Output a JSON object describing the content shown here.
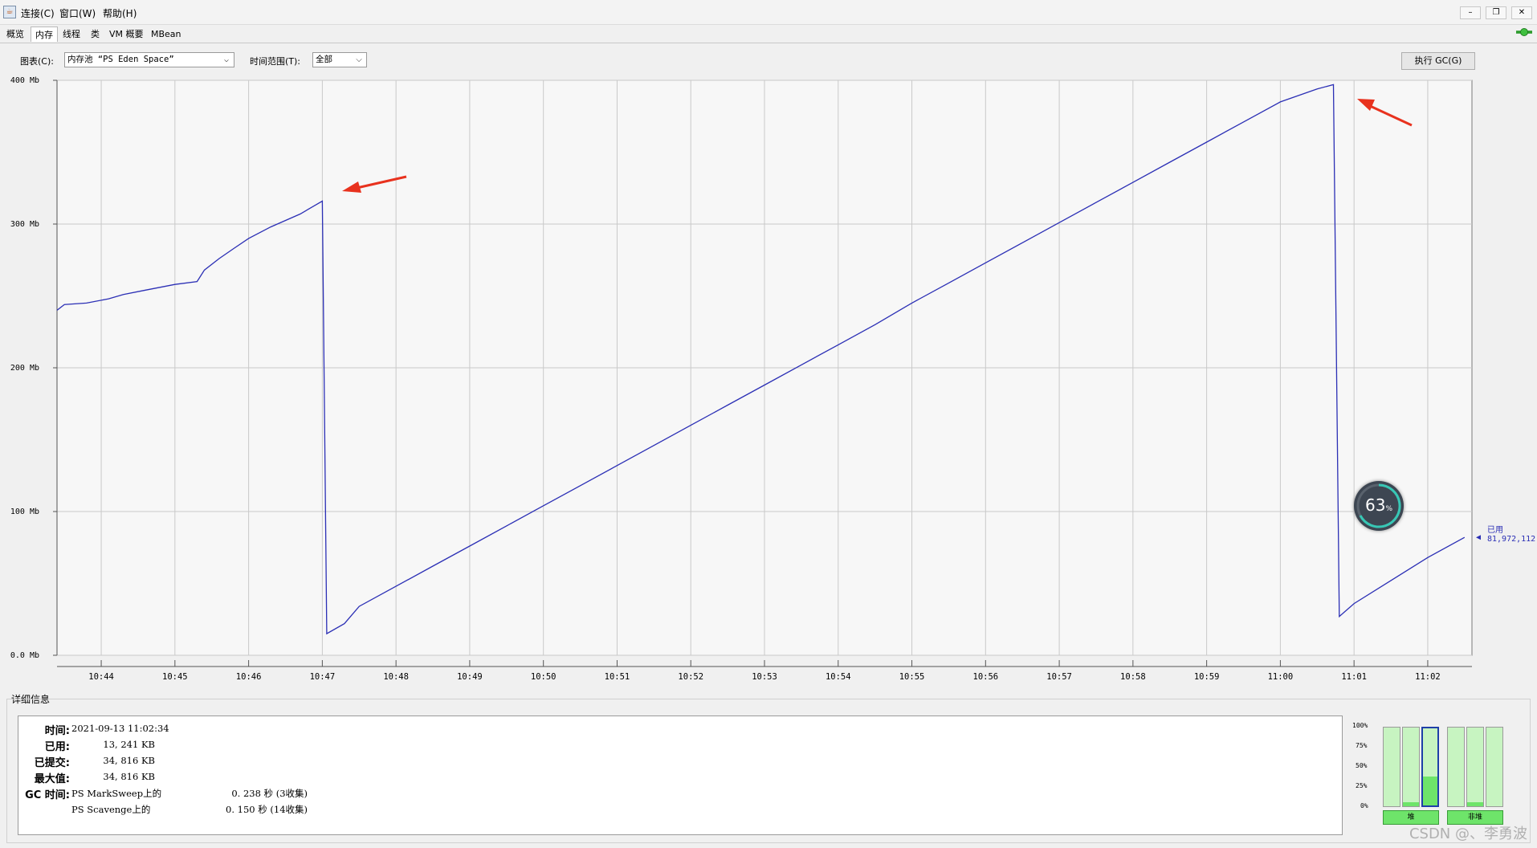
{
  "menu": {
    "items": [
      "连接(C)",
      "窗口(W)",
      "帮助(H)"
    ],
    "app_icon": "java-cup-icon"
  },
  "window_controls": [
    "–",
    "❐",
    "✕"
  ],
  "tabs": {
    "items": [
      "概览",
      "内存",
      "线程",
      "类",
      "VM 概要",
      "MBean"
    ],
    "active": "内存"
  },
  "toolbar": {
    "chart_label": "图表(C):",
    "chart_value": "内存池 “PS Eden Space”",
    "time_label": "时间范围(T):",
    "time_value": "全部",
    "gc_button": "执行 GC(G)"
  },
  "chart_data": {
    "type": "line",
    "y_ticks": [
      "400 Mb",
      "300 Mb",
      "200 Mb",
      "100 Mb",
      "0.0 Mb"
    ],
    "x_ticks": [
      "10:44",
      "10:45",
      "10:46",
      "10:47",
      "10:48",
      "10:49",
      "10:50",
      "10:51",
      "10:52",
      "10:53",
      "10:54",
      "10:55",
      "10:56",
      "10:57",
      "10:58",
      "10:59",
      "11:00",
      "11:01",
      "11:02"
    ],
    "ylim": [
      0,
      400
    ],
    "xlim": [
      43.4,
      62.6
    ],
    "x_units": "minutes past 10:00",
    "grid": true,
    "series_color": "#2b2fb5",
    "series": [
      {
        "name": "已用",
        "x": [
          43.4,
          43.5,
          43.8,
          44.1,
          44.3,
          44.6,
          45.0,
          45.3,
          45.4,
          45.6,
          45.8,
          46.0,
          46.3,
          46.7,
          47.0,
          47.06,
          47.3,
          47.5,
          48.0,
          48.5,
          49.0,
          49.5,
          50.0,
          50.5,
          51.0,
          51.5,
          52.0,
          52.5,
          53.0,
          53.5,
          54.0,
          54.5,
          55.0,
          55.5,
          56.0,
          56.5,
          57.0,
          57.5,
          58.0,
          58.5,
          59.0,
          59.5,
          60.0,
          60.5,
          60.72,
          60.8,
          61.0,
          61.5,
          62.0,
          62.5
        ],
        "values": [
          240,
          244,
          245,
          248,
          251,
          254,
          258,
          260,
          268,
          276,
          283,
          290,
          298,
          307,
          316,
          15,
          22,
          34,
          48,
          62,
          76,
          90,
          104,
          118,
          132,
          146,
          160,
          174,
          188,
          202,
          216,
          230,
          245,
          259,
          273,
          287,
          301,
          315,
          329,
          343,
          357,
          371,
          385,
          394,
          397,
          27,
          36,
          52,
          68,
          82
        ]
      }
    ],
    "value_label": "已用",
    "value_readout": "81,972,112"
  },
  "details": {
    "title": "详细信息",
    "rows": [
      {
        "label": "时间:",
        "value": "2021-09-13 11:02:34"
      },
      {
        "label": "已用:",
        "value": "13, 241 KB"
      },
      {
        "label": "已提交:",
        "value": "34, 816 KB"
      },
      {
        "label": "最大值:",
        "value": "34, 816 KB"
      }
    ],
    "gc_label": "GC 时间:",
    "gc_rows": [
      {
        "name": "PS MarkSweep上的",
        "value": "0. 238  秒 (3收集)"
      },
      {
        "name": "PS Scavenge上的",
        "value": "0. 150  秒 (14收集)"
      }
    ]
  },
  "pools": {
    "scale": [
      "100%",
      "75%",
      "50%",
      "25%",
      "0%"
    ],
    "heap_bars": [
      0.0,
      0.05,
      0.38
    ],
    "nonheap_bars": [
      0.0,
      0.05,
      0.0
    ],
    "heap_label": "堆",
    "nonheap_label": "非堆"
  },
  "gauge": {
    "value": "63",
    "unit": "%"
  },
  "watermark": "CSDN @、李勇波"
}
